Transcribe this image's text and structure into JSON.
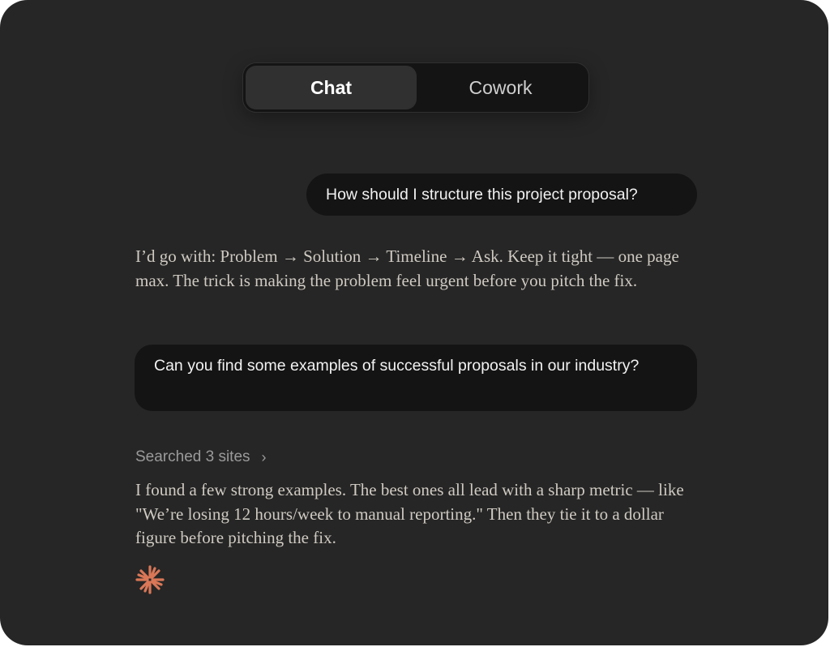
{
  "toggle": {
    "chat_label": "Chat",
    "cowork_label": "Cowork",
    "active": "Chat"
  },
  "messages": {
    "user_1": "How should I structure this project proposal?",
    "assistant_1": "I’d go with: Problem → Solution → Timeline → Ask. Keep it tight — one page max. The trick is making the problem feel urgent before you pitch the fix.",
    "user_2": "Can you find some examples of successful proposals in our industry?",
    "search_status": "Searched 3 sites",
    "assistant_2": "I found a few strong examples. The best ones all lead with a sharp metric — like \"We’re losing 12 hours/week to manual reporting.\" Then they tie it to a dollar figure before pitching the fix."
  },
  "icons": {
    "chevron": "chevron-right-icon",
    "activity": "spark-icon"
  },
  "colors": {
    "background": "#262626",
    "bubble": "#141414",
    "assistant_text": "#cfcac2",
    "muted": "#9a9a9a",
    "accent": "#d97757"
  }
}
